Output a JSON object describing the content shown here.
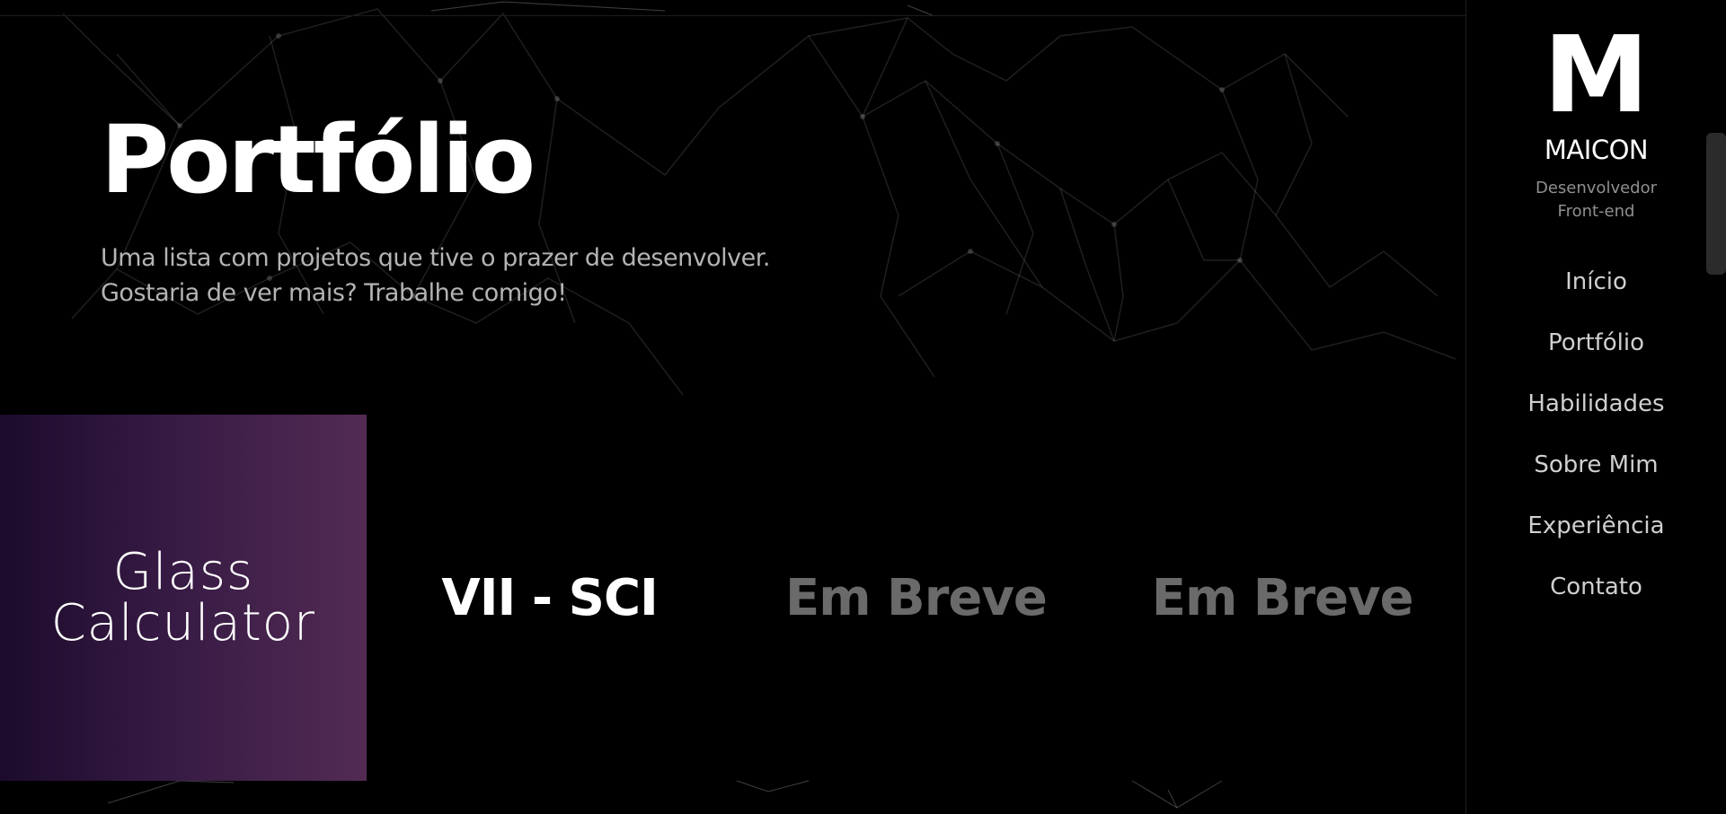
{
  "hero": {
    "title": "Portfólio",
    "subtitle_line1": "Uma lista com projetos que tive o prazer de desenvolver.",
    "subtitle_line2": "Gostaria de ver mais? Trabalhe comigo!"
  },
  "projects": [
    {
      "line1": "Glass",
      "line2": "Calculator"
    },
    {
      "label": "VII - SCI"
    },
    {
      "label": "Em Breve"
    },
    {
      "label": "Em Breve"
    }
  ],
  "sidebar": {
    "logo": "M",
    "name": "MAICON",
    "role_line1": "Desenvolvedor",
    "role_line2": "Front-end",
    "nav": [
      "Início",
      "Portfólio",
      "Habilidades",
      "Sobre Mim",
      "Experiência",
      "Contato"
    ]
  },
  "colors": {
    "background": "#000000",
    "glass_gradient_start": "#1c0b2c",
    "glass_gradient_end": "#522b53",
    "soon_text": "#6a6a6a",
    "network_lines": "#ffffff"
  },
  "icons": {
    "background": "particle-network"
  }
}
